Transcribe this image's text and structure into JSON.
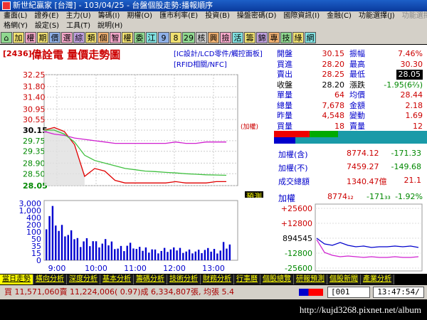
{
  "window": {
    "title": "新世紀贏家 [台灣] - 103/04/25 - 台盤個股走勢:播報順序"
  },
  "menu_row1": [
    "畫面(L)",
    "證券(E)",
    "主力(U)",
    "籌碼(I)",
    "期權(O)",
    "匯市利率(E)",
    "投資(B)",
    "操盤密碼(D)",
    "國際資訊(I)",
    "金融(C)",
    "功能選擇(J)",
    "功能選擇(P)"
  ],
  "menu_row2": [
    "格網(Y)",
    "設定(S)",
    "工具(T)",
    "說明(H)"
  ],
  "toolbar": [
    "加",
    "權",
    "期",
    "價",
    "選",
    "綜",
    "類",
    "個",
    "智",
    "權",
    "委",
    "江",
    "9",
    "8",
    "29",
    "核",
    "興",
    "撿",
    "活",
    "籌",
    "錦",
    "專",
    "技",
    "綠",
    "網"
  ],
  "header": {
    "code": "[2436]",
    "name": "偉詮電 量價走勢圖",
    "category1": "[IC設計/LCD零件/觸控面板]",
    "category2": "[RFID相關/NFC]"
  },
  "price_axis": [
    "32.25",
    "31.80",
    "31.40",
    "30.95",
    "30.55",
    "30.15",
    "29.75",
    "29.35",
    "28.90",
    "28.50",
    "28.05"
  ],
  "ref_label": "(加權)",
  "forecast_label": "預測",
  "volume_axis": [
    "3,000",
    "1,000",
    "400",
    "200",
    "100",
    "50",
    "35",
    "15",
    "0"
  ],
  "time_axis": [
    "9:00",
    "10:00",
    "11:00",
    "12:00",
    "13:00"
  ],
  "quote": [
    {
      "l1": "開盤",
      "v1": "30.15",
      "l2": "振幅",
      "v2": "7.46%"
    },
    {
      "l1": "買進",
      "v1": "28.20",
      "l2": "最高",
      "v2": "30.30"
    },
    {
      "l1": "賣出",
      "v1": "28.25",
      "l2": "最低",
      "v2": "28.05"
    },
    {
      "l1": "收盤",
      "v1": "28.20",
      "l2": "漲跌",
      "v2": "-1.95(6⅔)"
    },
    {
      "l1": "單量",
      "v1": "64",
      "l2": "均價",
      "v2": "28.44"
    },
    {
      "l1": "總量",
      "v1": "7,678",
      "l2": "金額",
      "v2": "2.18"
    },
    {
      "l1": "昨量",
      "v1": "4,548",
      "l2": "變動",
      "v2": "1.69"
    },
    {
      "l1": "買量",
      "v1": "18",
      "l2": "賣量",
      "v2": "12"
    }
  ],
  "index": {
    "r1_label": "加權(含)",
    "r1_value": "8774.12",
    "r1_change": "-171.33",
    "r2_label": "加權(不)",
    "r2_value": "7459.27",
    "r2_change": "-149.68",
    "r3_label": "成交總額",
    "r3_value": "1340.47億",
    "r3_change": "21.1"
  },
  "mini": {
    "label": "加權",
    "value": "8774₁₂",
    "change": "-171₃₃",
    "pct": "-1.92%",
    "axis": [
      "+25600",
      "+12800",
      "894545",
      "-12800",
      "-25600"
    ]
  },
  "bottom_tabs": [
    "當日走勢",
    "橫向分析",
    "深度分析",
    "基本分析",
    "籌碼分析",
    "技術分析",
    "財務分析",
    "行事曆",
    "個股總覽",
    "研報預測",
    "個股新聞",
    "產業分析"
  ],
  "status": {
    "text": "買 11,571,060賣 11,224,006( 0.97)成 6,334,807張, 均張 5.4",
    "code": "[001",
    "time": "13:47:54/"
  },
  "watermark": "http://kujd3268.pixnet.net/album",
  "chart_data": {
    "type": "line",
    "x": [
      "9:00",
      "9:15",
      "9:30",
      "9:45",
      "10:00",
      "10:15",
      "10:30",
      "10:45",
      "11:00",
      "11:15",
      "11:30",
      "11:45",
      "12:00",
      "12:15",
      "12:30",
      "12:45",
      "13:00",
      "13:15",
      "13:30"
    ],
    "series": [
      {
        "values": [
          30.15,
          30.25,
          30.1,
          29.6,
          28.4,
          28.7,
          28.6,
          28.25,
          28.15,
          28.15,
          28.15,
          28.15,
          28.15,
          28.2,
          28.15,
          28.15,
          28.15,
          28.2,
          28.2
        ]
      },
      {
        "values": [
          30.1,
          30.0,
          29.95,
          29.85,
          29.8,
          29.75,
          29.7,
          29.65,
          29.65,
          29.65,
          29.65,
          29.65,
          29.65,
          29.7,
          29.65,
          29.65,
          29.7,
          29.7,
          29.7
        ]
      },
      {
        "values": [
          30.15,
          30.15,
          30.0,
          29.7,
          29.2,
          29.0,
          28.9,
          28.8,
          28.7,
          28.65,
          28.6,
          28.58,
          28.55,
          28.53,
          28.5,
          28.48,
          28.46,
          28.45,
          28.44
        ]
      }
    ],
    "colors": [
      "#e00000",
      "#d020d0",
      "#40c040"
    ],
    "ylim": [
      28.05,
      32.25
    ],
    "volume": [
      2300,
      900,
      600,
      420,
      380,
      260,
      300,
      160,
      220,
      120,
      140,
      90,
      110,
      130,
      90,
      80,
      100,
      110,
      260
    ],
    "volume_color": "#0000d0"
  }
}
